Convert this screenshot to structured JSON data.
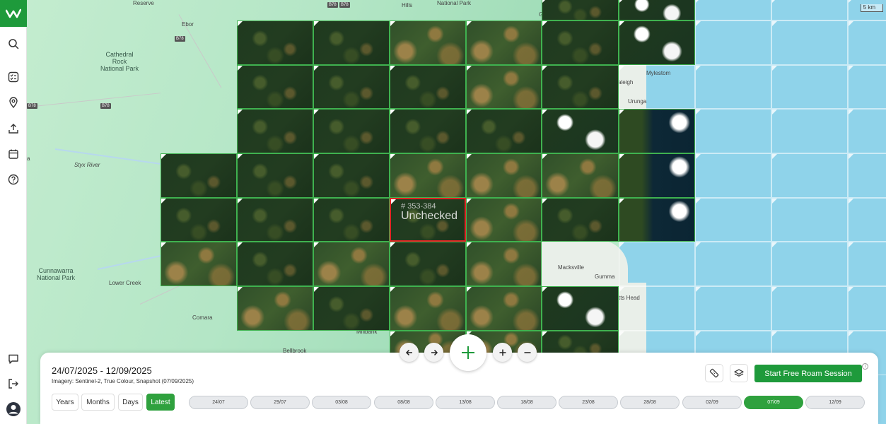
{
  "map": {
    "scale": "5 km",
    "labels": {
      "reserve": "Reserve",
      "ebor": "Ebor",
      "cathedral": "Cathedral\nRock\nNational Park",
      "styx": "Styx River",
      "cunnawarra": "Cunnawarra\nNational Park",
      "lower_creek": "Lower Creek",
      "comara": "Comara",
      "hills": "Hills",
      "national_park_top": "National Park",
      "mylestom": "Mylestom",
      "raleigh": "aleigh",
      "urunga": "Urunga",
      "macksville": "Macksville",
      "gumma": "Gumma",
      "scotts_head": "tts Head",
      "millbank": "Millbank",
      "bellbrook": "Bellbrook",
      "g_label": "G",
      "a_label": "a"
    },
    "shields": {
      "b78_a": "B78",
      "b78_b": "B78",
      "b78_c": "B78",
      "b78_d": "B78",
      "b78_e": "B78"
    },
    "selected_tile": {
      "id": "# 353-384",
      "status": "Unchecked"
    }
  },
  "panel": {
    "date_range": "24/07/2025 - 12/09/2025",
    "imagery": "Imagery: Sentinel-2, True Colour, Snapshot (07/09/2025)",
    "periods": [
      "Years",
      "Months",
      "Days",
      "Latest"
    ],
    "active_period": "Latest",
    "dates": [
      "24/07",
      "29/07",
      "03/08",
      "08/08",
      "13/08",
      "18/08",
      "23/08",
      "28/08",
      "02/09",
      "07/09",
      "12/09"
    ],
    "active_date": "07/09",
    "roam_button": "Start Free Roam Session"
  },
  "icons": {
    "sidebar": [
      "search-icon",
      "checklist-icon",
      "location-pin-icon",
      "upload-icon",
      "calendar-icon",
      "help-icon"
    ],
    "sidebar_bottom": [
      "chat-icon",
      "logout-icon",
      "avatar-icon"
    ],
    "panel": [
      "ruler-icon",
      "layers-icon",
      "info-icon"
    ]
  },
  "colors": {
    "brand": "#1e9a3b",
    "grid": "#3fb24f",
    "selected": "#e02424",
    "sea": "#8fd3ea"
  }
}
